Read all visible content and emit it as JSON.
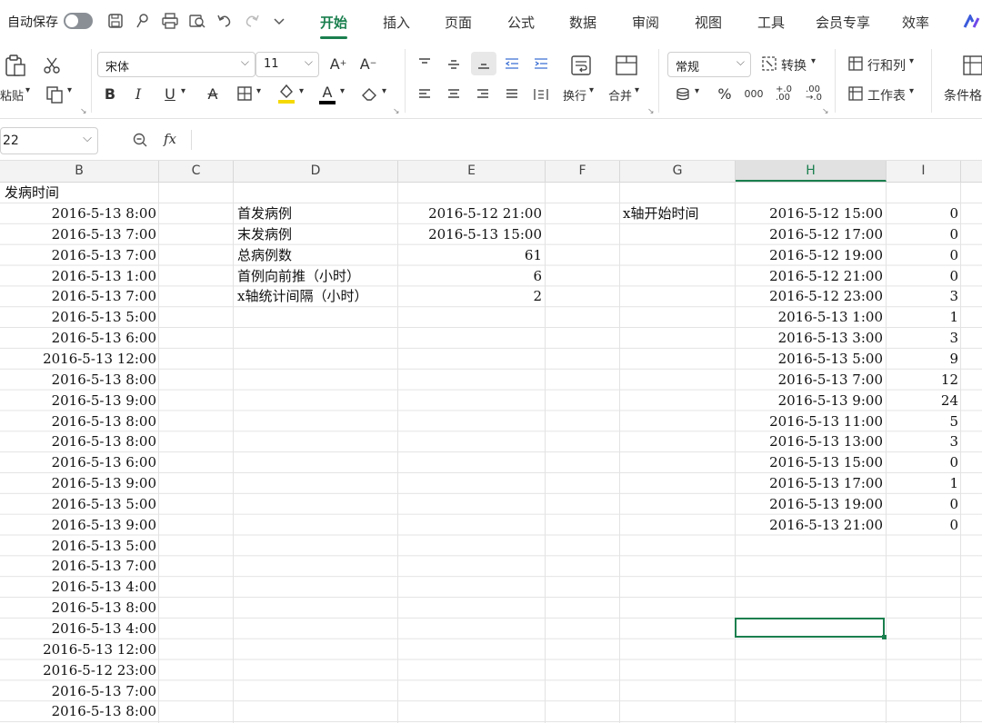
{
  "titlebar": {
    "autosave_label": "自动保存"
  },
  "tabs": [
    {
      "label": "开始",
      "active": true
    },
    {
      "label": "插入"
    },
    {
      "label": "页面"
    },
    {
      "label": "公式"
    },
    {
      "label": "数据"
    },
    {
      "label": "审阅"
    },
    {
      "label": "视图"
    },
    {
      "label": "工具"
    },
    {
      "label": "会员专享"
    },
    {
      "label": "效率"
    }
  ],
  "ribbon": {
    "paste_label": "粘贴",
    "font_name": "宋体",
    "font_size": "11",
    "number_format": "常规",
    "convert_label": "转换",
    "rows_cols_label": "行和列",
    "worksheet_label": "工作表",
    "wrap_label": "换行",
    "merge_label": "合并",
    "condfmt_label": "条件格",
    "accent_color": "#1a7f4e",
    "highlight_color": "#f5d900",
    "font_color": "#000000"
  },
  "formula_bar": {
    "name_box": "22",
    "fx": "fx",
    "content": ""
  },
  "columns": [
    "B",
    "C",
    "D",
    "E",
    "F",
    "G",
    "H",
    "I"
  ],
  "selected_column": "H",
  "col_b": {
    "header": "发病时间",
    "values": [
      "2016-5-13 8:00",
      "2016-5-13 7:00",
      "2016-5-13 7:00",
      "2016-5-13 1:00",
      "2016-5-13 7:00",
      "2016-5-13 5:00",
      "2016-5-13 6:00",
      "2016-5-13 12:00",
      "2016-5-13 8:00",
      "2016-5-13 9:00",
      "2016-5-13 8:00",
      "2016-5-13 8:00",
      "2016-5-13 6:00",
      "2016-5-13 9:00",
      "2016-5-13 5:00",
      "2016-5-13 9:00",
      "2016-5-13 5:00",
      "2016-5-13 7:00",
      "2016-5-13 4:00",
      "2016-5-13 8:00",
      "2016-5-13 4:00",
      "2016-5-13 12:00",
      "2016-5-12 23:00",
      "2016-5-13 7:00",
      "2016-5-13 8:00"
    ]
  },
  "summary": [
    {
      "label": "首发病例",
      "value": "2016-5-12 21:00"
    },
    {
      "label": "末发病例",
      "value": "2016-5-13 15:00"
    },
    {
      "label": "总病例数",
      "value": "61"
    },
    {
      "label": "首例向前推（小时）",
      "value": "6"
    },
    {
      "label": "x轴统计间隔（小时）",
      "value": "2"
    }
  ],
  "axis_label": "x轴开始时间",
  "axis_rows": [
    {
      "time": "2016-5-12 15:00",
      "count": "0"
    },
    {
      "time": "2016-5-12 17:00",
      "count": "0"
    },
    {
      "time": "2016-5-12 19:00",
      "count": "0"
    },
    {
      "time": "2016-5-12 21:00",
      "count": "0"
    },
    {
      "time": "2016-5-12 23:00",
      "count": "3"
    },
    {
      "time": "2016-5-13 1:00",
      "count": "1"
    },
    {
      "time": "2016-5-13 3:00",
      "count": "3"
    },
    {
      "time": "2016-5-13 5:00",
      "count": "9"
    },
    {
      "time": "2016-5-13 7:00",
      "count": "12"
    },
    {
      "time": "2016-5-13 9:00",
      "count": "24"
    },
    {
      "time": "2016-5-13 11:00",
      "count": "5"
    },
    {
      "time": "2016-5-13 13:00",
      "count": "3"
    },
    {
      "time": "2016-5-13 15:00",
      "count": "0"
    },
    {
      "time": "2016-5-13 17:00",
      "count": "1"
    },
    {
      "time": "2016-5-13 19:00",
      "count": "0"
    },
    {
      "time": "2016-5-13 21:00",
      "count": "0"
    }
  ]
}
